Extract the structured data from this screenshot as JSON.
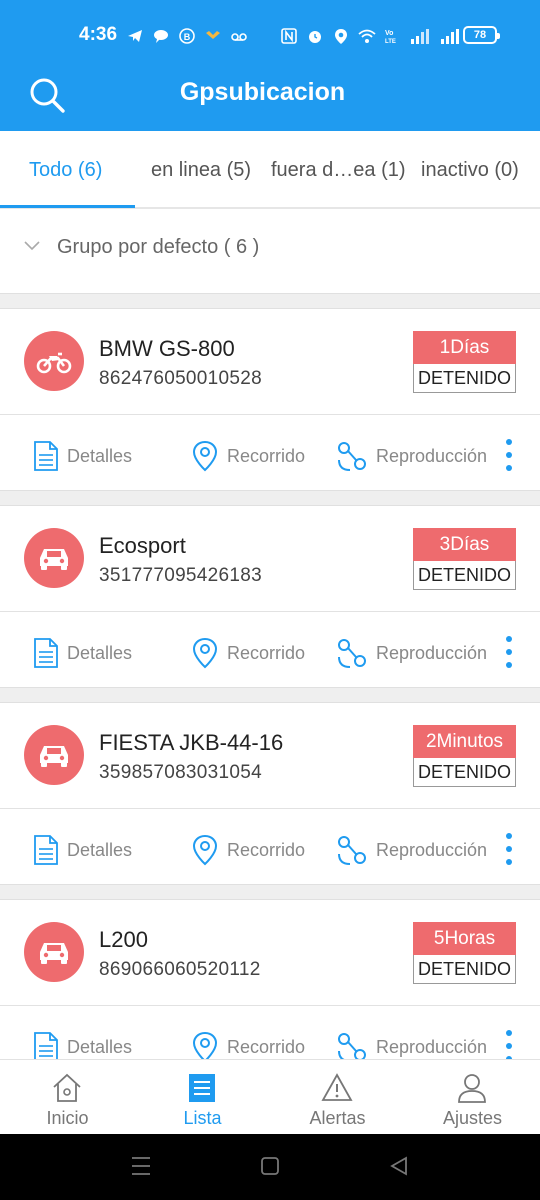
{
  "status_bar": {
    "time": "4:36",
    "battery": "78"
  },
  "header": {
    "title": "Gpsubicacion"
  },
  "tabs": [
    {
      "label": "Todo (6)",
      "active": true
    },
    {
      "label": "en linea (5)",
      "active": false
    },
    {
      "label": "fuera d…ea (1)",
      "active": false
    },
    {
      "label": "inactivo (0)",
      "active": false
    }
  ],
  "group": {
    "label": "Grupo por defecto ( 6 )"
  },
  "vehicles": [
    {
      "name": "BMW GS-800",
      "imei": "862476050010528",
      "duration": "1Días",
      "status": "DETENIDO",
      "icon": "motorcycle-icon"
    },
    {
      "name": "Ecosport",
      "imei": "351777095426183",
      "duration": "3Días",
      "status": "DETENIDO",
      "icon": "car-icon"
    },
    {
      "name": "FIESTA JKB-44-16",
      "imei": "359857083031054",
      "duration": "2Minutos",
      "status": "DETENIDO",
      "icon": "car-icon"
    },
    {
      "name": "L200",
      "imei": "869066060520112",
      "duration": "5Horas",
      "status": "DETENIDO",
      "icon": "car-icon"
    }
  ],
  "actions": {
    "details": "Detalles",
    "route": "Recorrido",
    "playback": "Reproducción"
  },
  "bottom_nav": [
    {
      "label": "Inicio",
      "icon": "home-icon",
      "active": false
    },
    {
      "label": "Lista",
      "icon": "list-icon",
      "active": true
    },
    {
      "label": "Alertas",
      "icon": "alert-icon",
      "active": false
    },
    {
      "label": "Ajustes",
      "icon": "user-icon",
      "active": false
    }
  ],
  "colors": {
    "primary": "#1f9bf0",
    "badge_red": "#ee6b6e"
  }
}
